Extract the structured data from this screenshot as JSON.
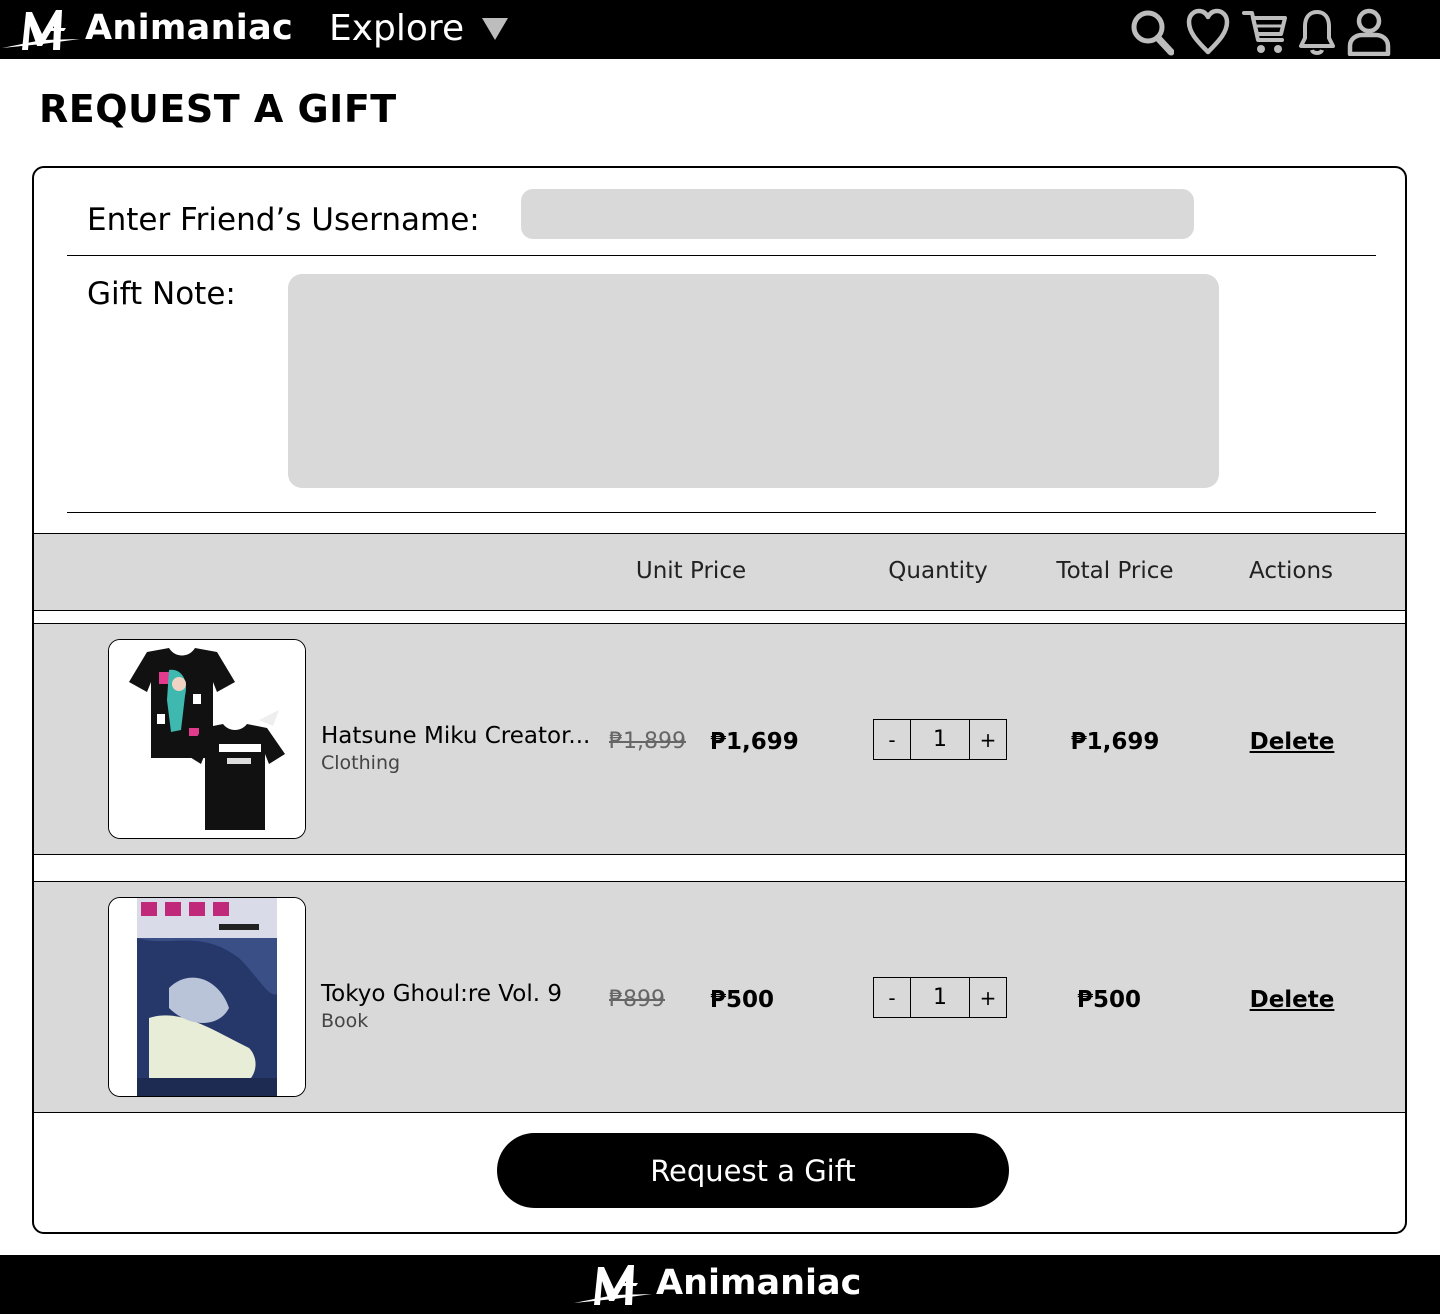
{
  "brand": {
    "name": "Animaniac"
  },
  "nav": {
    "explore_label": "Explore",
    "icons": [
      "search-icon",
      "heart-icon",
      "cart-icon",
      "bell-icon",
      "user-icon"
    ]
  },
  "page": {
    "title": "REQUEST A GIFT"
  },
  "form": {
    "username_label": "Enter Friend’s Username:",
    "username_value": "",
    "note_label": "Gift Note:",
    "note_value": ""
  },
  "table": {
    "headers": {
      "unit_price": "Unit Price",
      "quantity": "Quantity",
      "total_price": "Total Price",
      "actions": "Actions"
    },
    "items": [
      {
        "name": "Hatsune Miku Creator...",
        "category": "Clothing",
        "old_price": "₱1,899",
        "unit_price": "₱1,699",
        "quantity": "1",
        "total_price": "₱1,699",
        "action": "Delete",
        "thumb_icon": "tshirt-image"
      },
      {
        "name": "Tokyo Ghoul:re Vol. 9",
        "category": "Book",
        "old_price": "₱899",
        "unit_price": "₱500",
        "quantity": "1",
        "total_price": "₱500",
        "action": "Delete",
        "thumb_icon": "book-cover-image"
      }
    ],
    "stepper": {
      "minus": "-",
      "plus": "+"
    }
  },
  "cta": {
    "label": "Request a Gift"
  },
  "footer": {
    "brand_name": "Animaniac"
  },
  "colors": {
    "bar": "#000000",
    "panel": "#d9d9d9",
    "background": "#ffffff"
  }
}
